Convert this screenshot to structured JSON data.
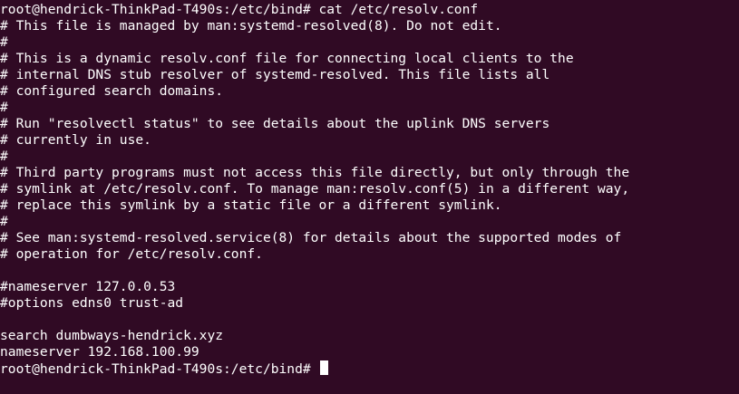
{
  "terminal": {
    "background": "#300a24",
    "foreground": "#ffffff",
    "command_line": "root@hendrick-ThinkPad-T490s:/etc/bind# cat /etc/resolv.conf",
    "output": [
      "# This file is managed by man:systemd-resolved(8). Do not edit.",
      "#",
      "# This is a dynamic resolv.conf file for connecting local clients to the",
      "# internal DNS stub resolver of systemd-resolved. This file lists all",
      "# configured search domains.",
      "#",
      "# Run \"resolvectl status\" to see details about the uplink DNS servers",
      "# currently in use.",
      "#",
      "# Third party programs must not access this file directly, but only through the",
      "# symlink at /etc/resolv.conf. To manage man:resolv.conf(5) in a different way,",
      "# replace this symlink by a static file or a different symlink.",
      "#",
      "# See man:systemd-resolved.service(8) for details about the supported modes of",
      "# operation for /etc/resolv.conf.",
      "",
      "#nameserver 127.0.0.53",
      "#options edns0 trust-ad",
      "",
      "search dumbways-hendrick.xyz",
      "nameserver 192.168.100.99"
    ],
    "prompt": "root@hendrick-ThinkPad-T490s:/etc/bind# "
  }
}
